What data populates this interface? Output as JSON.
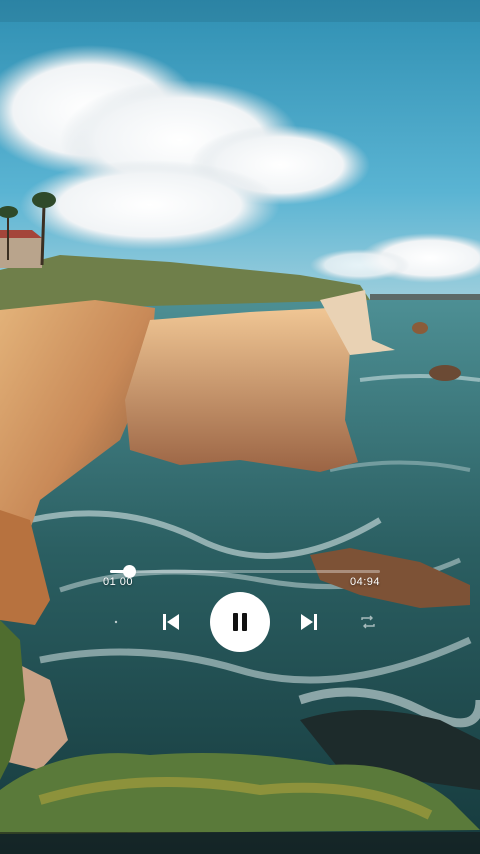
{
  "player": {
    "elapsed": "01 00",
    "total": "04:94",
    "progress": 0.07
  },
  "icons": {
    "prev": "skip-previous-icon",
    "play_pause": "pause-icon",
    "next": "skip-next-icon",
    "shuffle": "shuffle-icon",
    "repeat": "repeat-icon"
  },
  "colors": {
    "control": "#ffffff",
    "pause_glyph": "#111111"
  }
}
